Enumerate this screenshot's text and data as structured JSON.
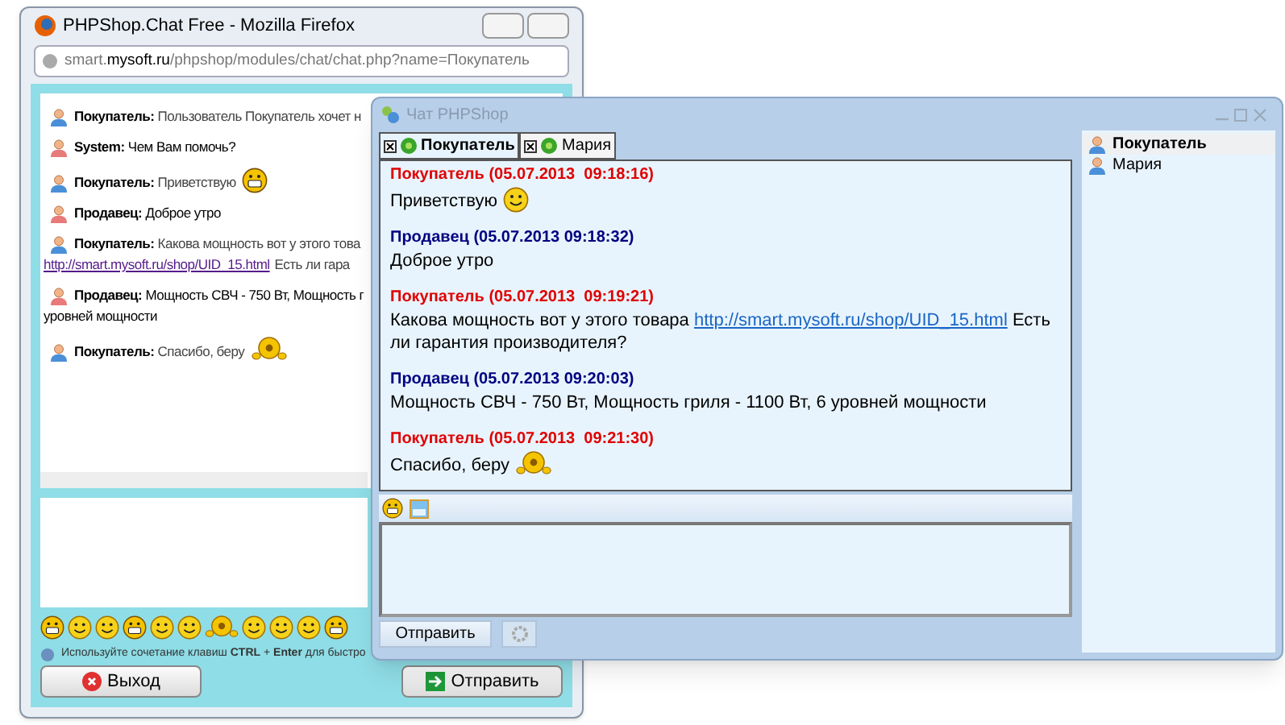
{
  "browser": {
    "title": "PHPShop.Chat Free - Mozilla Firefox",
    "url_host": "smart.",
    "url_domain": "mysoft.ru",
    "url_path": "/phpshop/modules/chat/chat.php?name=Покупатель",
    "messages": [
      {
        "author": "Покупатель:",
        "kind": "buyer",
        "text": "Пользователь Покупатель хочет н"
      },
      {
        "author": "System:",
        "kind": "seller",
        "text": "Чем Вам помочь?"
      },
      {
        "author": "Покупатель:",
        "kind": "buyer",
        "text": "Приветствую",
        "emoticon": {
          "kind": "grin"
        }
      },
      {
        "author": "Продавец:",
        "kind": "seller",
        "text": "Доброе утро"
      },
      {
        "author": "Покупатель:",
        "kind": "buyer",
        "text": "Какова мощность вот у этого това",
        "link": "http://smart.mysoft.ru/shop/UID_15.html",
        "after": "Есть ли гара"
      },
      {
        "author": "Продавец:",
        "kind": "seller",
        "text": "Мощность СВЧ - 750 Вт, Мощность г",
        "continuation": "уровней мощности"
      },
      {
        "author": "Покупатель:",
        "kind": "buyer",
        "text": "Спасибо, беру",
        "emoticon": {
          "kind": "wave"
        }
      }
    ],
    "hint": "Используйте сочетание клавиш **CTRL** + **Enter** для быстро",
    "exit_button": "Выход",
    "send_button": "Отправить"
  },
  "chat": {
    "title": "Чат PHPShop",
    "tabs": [
      {
        "label": "Покупатель",
        "selected": true
      },
      {
        "label": "Мария",
        "selected": false
      }
    ],
    "messages": [
      {
        "author": "Покупатель",
        "kind": "buyer",
        "time": "(05.07.2013  09:18:16)",
        "text": "Приветствую",
        "emoticon": {
          "kind": "smile"
        }
      },
      {
        "author": "Продавец",
        "kind": "seller",
        "time": "(05.07.2013 09:18:32)",
        "text": "Доброе утро"
      },
      {
        "author": "Покупатель",
        "kind": "buyer",
        "time": "(05.07.2013  09:19:21)",
        "text": "Какова мощность вот у этого товара",
        "link": "http://smart.mysoft.ru/shop/UID_15.html",
        "after": "Есть ли гарантия производителя?"
      },
      {
        "author": "Продавец",
        "kind": "seller",
        "time": "(05.07.2013 09:20:03)",
        "text": "Мощность СВЧ - 750 Вт, Мощность гриля - 1100 Вт, 6 уровней мощности"
      },
      {
        "author": "Покупатель",
        "kind": "buyer",
        "time": "(05.07.2013  09:21:30)",
        "text": "Спасибо, беру",
        "emoticon": {
          "kind": "wave"
        }
      }
    ],
    "send_button": "Отправить",
    "users": [
      {
        "name": "Покупатель",
        "selected": true
      },
      {
        "name": "Мария",
        "selected": false
      }
    ]
  }
}
